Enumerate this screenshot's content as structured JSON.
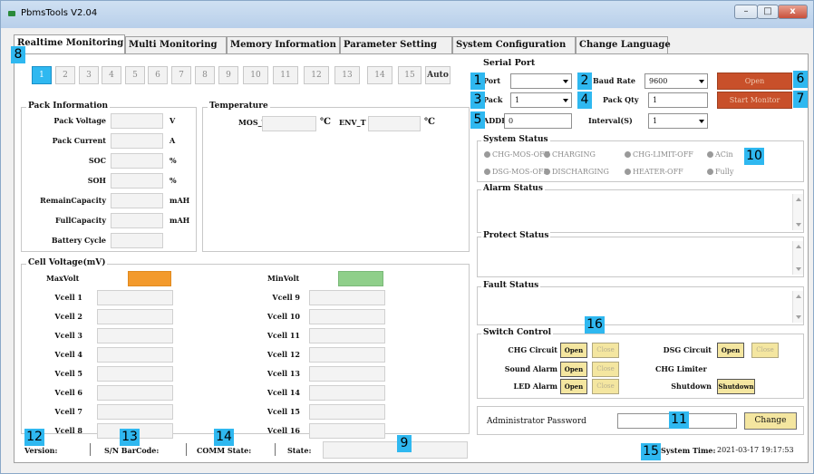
{
  "window": {
    "title": "PbmsTools V2.04",
    "minimize": "–",
    "maximize": "□",
    "close": "x"
  },
  "tabs": [
    "Realtime Monitoring",
    "Multi Monitoring",
    "Memory Information",
    "Parameter Setting",
    "System Configuration",
    "Change Language"
  ],
  "cell_buttons": [
    "1",
    "2",
    "3",
    "4",
    "5",
    "6",
    "7",
    "8",
    "9",
    "10",
    "11",
    "12",
    "13",
    "14",
    "15",
    "Auto"
  ],
  "pack_info": {
    "title": "Pack Information",
    "rows": [
      {
        "label": "Pack Voltage",
        "unit": "V"
      },
      {
        "label": "Pack Current",
        "unit": "A"
      },
      {
        "label": "SOC",
        "unit": "%"
      },
      {
        "label": "SOH",
        "unit": "%"
      },
      {
        "label": "RemainCapacity",
        "unit": "mAH"
      },
      {
        "label": "FullCapacity",
        "unit": "mAH"
      },
      {
        "label": "Battery Cycle",
        "unit": ""
      }
    ]
  },
  "temperature": {
    "title": "Temperature",
    "mos_label": "MOS_T",
    "env_label": "ENV_T",
    "unit": "℃"
  },
  "cell_voltage": {
    "title": "Cell Voltage(mV)",
    "max_label": "MaxVolt",
    "min_label": "MinVolt",
    "max_color": "#f39a2c",
    "min_color": "#8fcf8a",
    "left": [
      "Vcell 1",
      "Vcell 2",
      "Vcell 3",
      "Vcell 4",
      "Vcell 5",
      "Vcell 6",
      "Vcell 7",
      "Vcell 8"
    ],
    "right": [
      "Vcell 9",
      "Vcell 10",
      "Vcell 11",
      "Vcell 12",
      "Vcell 13",
      "Vcell 14",
      "Vcell 15",
      "Vcell 16"
    ]
  },
  "serial": {
    "title": "Serial Port",
    "port_label": "Port",
    "port_value": "",
    "baud_label": "Baud Rate",
    "baud_value": "9600",
    "open_label": "Open",
    "pack_label": "Pack",
    "pack_value": "1",
    "packqty_label": "Pack Qty",
    "packqty_value": "1",
    "start_label": "Start Monitor",
    "addr_label": "ADDR",
    "addr_value": "0",
    "interval_label": "Interval(S)",
    "interval_value": "1",
    "button_color": "#c8502a"
  },
  "system_status": {
    "title": "System Status",
    "row1": [
      "CHG-MOS-OFF",
      "CHARGING",
      "CHG-LIMIT-OFF",
      "ACin"
    ],
    "row2": [
      "DSG-MOS-OFF",
      "DISCHARGING",
      "HEATER-OFF",
      "Fully"
    ]
  },
  "alarm_title": "Alarm Status",
  "protect_title": "Protect Status",
  "fault_title": "Fault Status",
  "switch_control": {
    "title": "Switch Control",
    "chg": "CHG Circuit",
    "dsg": "DSG Circuit",
    "sound": "Sound Alarm",
    "chg_limiter": "CHG Limiter",
    "led": "LED Alarm",
    "shutdown": "Shutdown",
    "open": "Open",
    "close": "Close",
    "shutdown_btn": "Shutdown"
  },
  "admin": {
    "label": "Administrator Password",
    "change": "Change"
  },
  "statusbar": {
    "version": "Version:",
    "sn": "S/N BarCode:",
    "comm": "COMM State:",
    "state": "State:",
    "system_time_label": "System Time:",
    "system_time": "2021-03-17 19:17:53"
  },
  "badges": [
    "1",
    "2",
    "3",
    "4",
    "5",
    "6",
    "7",
    "8",
    "9",
    "10",
    "11",
    "12",
    "13",
    "14",
    "15",
    "16"
  ],
  "badge_color": "#2fb8f0"
}
